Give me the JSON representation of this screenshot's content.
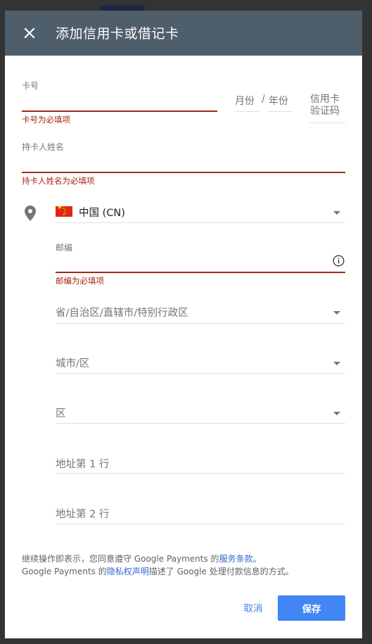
{
  "dialog": {
    "title": "添加信用卡或借记卡",
    "close_icon": "close-icon"
  },
  "card": {
    "number_label": "卡号",
    "number_error": "卡号为必填项",
    "month_placeholder": "月份",
    "separator": "/",
    "year_placeholder": "年份",
    "cvc_line1": "信用卡",
    "cvc_line2": "验证码"
  },
  "holder": {
    "label": "持卡人姓名",
    "error": "持卡人姓名为必填项"
  },
  "address": {
    "location_icon": "location-pin-icon",
    "country": "中国 (CN)",
    "postal_label": "邮编",
    "postal_error": "邮编为必填项",
    "info_icon": "info-icon",
    "province_placeholder": "省/自治区/直辖市/特别行政区",
    "city_placeholder": "城市/区",
    "district_placeholder": "区",
    "line1_placeholder": "地址第 1 行",
    "line2_placeholder": "地址第 2 行"
  },
  "terms": {
    "line1_prefix": "继续操作即表示，您同意遵守 Google Payments 的",
    "tos_link": "服务条款",
    "line1_suffix": "。",
    "line2_prefix": "Google Payments 的",
    "privacy_link": "隐私权声明",
    "line2_suffix": "描述了 Google 处理付款信息的方式。"
  },
  "actions": {
    "cancel_label": "取消",
    "save_label": "保存"
  },
  "colors": {
    "header": "#4f5e6b",
    "error": "#a52714",
    "primary": "#4285f4",
    "link": "#3367d6"
  }
}
